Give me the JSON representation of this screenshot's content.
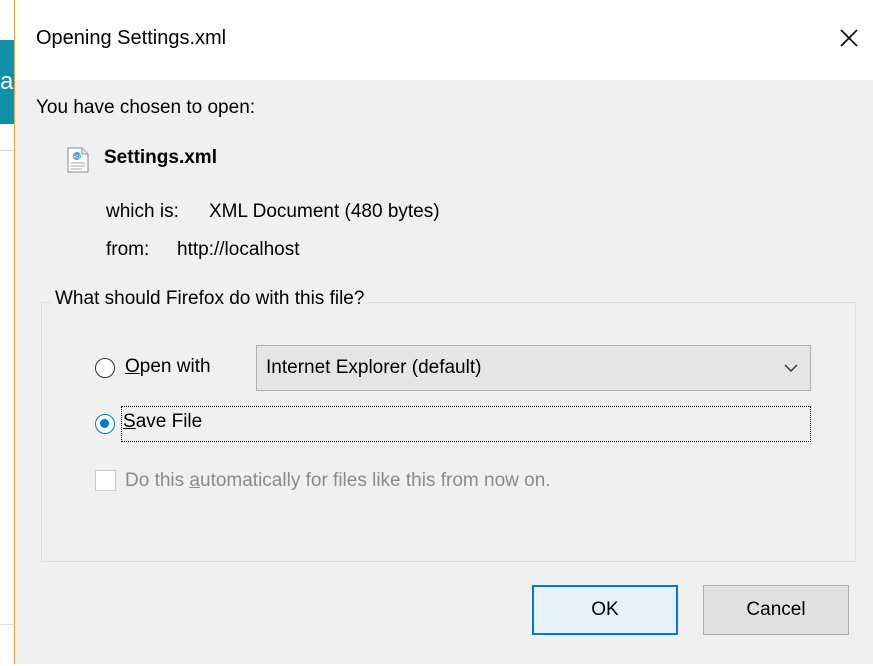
{
  "background_app": {
    "tab_glyph": "a",
    "accent_color": "#0f8fa8"
  },
  "dialog": {
    "title": "Opening Settings.xml",
    "close_icon": "close-icon",
    "intro": "You have chosen to open:",
    "file": {
      "icon": "xml-file-icon",
      "name": "Settings.xml",
      "which_is_label": "which is:",
      "which_is_value": "XML Document (480 bytes)",
      "from_label": "from:",
      "from_value": "http://localhost"
    },
    "group": {
      "legend": "What should Firefox do with this file?",
      "open_with": {
        "mnemonic": "O",
        "rest": "pen with",
        "selected": false,
        "app_value": "Internet Explorer (default)"
      },
      "save_file": {
        "mnemonic": "S",
        "rest": "ave File",
        "selected": true
      },
      "auto_checkbox": {
        "prefix": "Do this ",
        "mnemonic": "a",
        "suffix": "utomatically for files like this from now on.",
        "checked": false,
        "enabled": false
      }
    },
    "buttons": {
      "ok": "OK",
      "cancel": "Cancel"
    },
    "colors": {
      "accent": "#0078d7",
      "window_border": "#e8a642"
    }
  }
}
